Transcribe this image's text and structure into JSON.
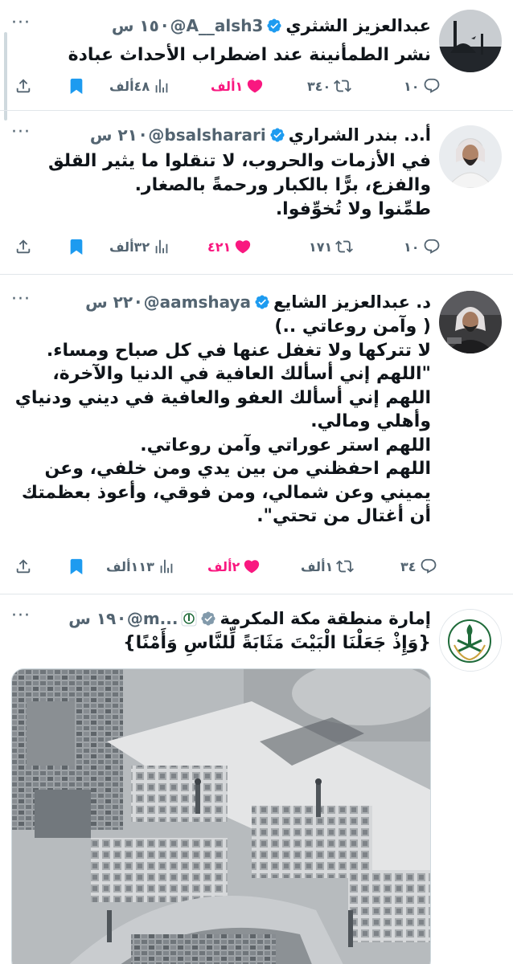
{
  "tweets": [
    {
      "name": "عبدالعزيز الشثري",
      "handle": "@A__alsh3",
      "time": "١٥ س",
      "text": "نشر الطمأنينة عند اضطراب الأحداث عبادة",
      "replies": "١٠",
      "retweets": "٣٤٠",
      "likes": "١ألف",
      "views": "٤٨ألف",
      "liked": true
    },
    {
      "name": "أ.د. بندر الشراري",
      "handle": "@bsalsharari",
      "time": "٢١ س",
      "text": "في الأزمات والحروب، لا تنقلوا ما يثير القلق\nوالفزع، برًّا بالكبار ورحمةً بالصغار.\nطمِّنوا ولا تُخوِّفوا.",
      "replies": "١٠",
      "retweets": "١٧١",
      "likes": "٤٢١",
      "views": "٣٢ألف",
      "liked": true
    },
    {
      "name": "د. عبدالعزيز الشايع",
      "handle": "@aamshaya",
      "time": "٢٢ س",
      "text": "( وآمن روعاتي ..)\nلا تتركها ولا تغفل عنها في كل صباح ومساء.\n\"اللهم إني أسألك العافية في الدنيا والآخرة،\nاللهم إني أسألك العفو والعافية في ديني ودنياي\nوأهلي ومالي.\nاللهم استر عوراتي وآمن روعاتي.\nاللهم احفظني من بين يدي ومن خلفي، وعن\nيميني وعن شمالي، ومن فوقي، وأعوذ بعظمتك\nأن أغتال من تحتي\".",
      "replies": "٣٤",
      "retweets": "١ألف",
      "likes": "٢ألف",
      "views": "١١٣ألف",
      "liked": true
    },
    {
      "name": "إمارة منطقة مكة المكرمة",
      "handle": "@m...",
      "time": "١٩ س",
      "text": "{وَإِذْ جَعَلْنَا الْبَيْتَ مَثَابَةً لِّلنَّاسِ وَأَمْنًا}"
    }
  ],
  "separator": "·",
  "more_label": "···",
  "colors": {
    "like": "#f91880",
    "verified": "#1d9bf0",
    "muted": "#536471",
    "text": "#0f1419"
  },
  "icons": [
    "reply-icon",
    "retweet-icon",
    "heart-icon",
    "views-icon",
    "bookmark-icon",
    "share-icon",
    "verified-badge-icon"
  ]
}
